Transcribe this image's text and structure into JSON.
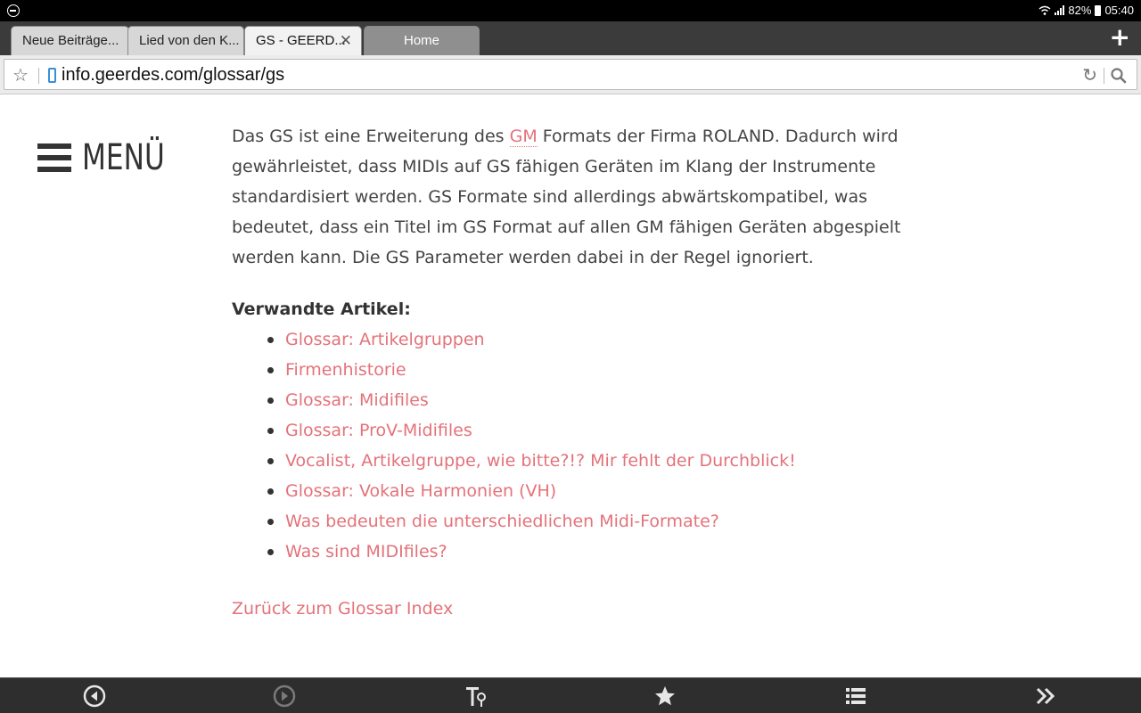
{
  "status_bar": {
    "battery": "82%",
    "time": "05:40"
  },
  "tabs": [
    {
      "label": "Neue Beiträge..."
    },
    {
      "label": "Lied von den K..."
    },
    {
      "label": "GS - GEERD...",
      "active": true
    },
    {
      "label": "Home"
    }
  ],
  "address_bar": {
    "url": "info.geerdes.com/glossar/gs"
  },
  "page": {
    "menu_label": "MENÜ",
    "intro_before_link": "Das GS ist eine Erweiterung des ",
    "intro_link": "GM",
    "intro_after_link": " Formats der Firma ROLAND. Dadurch wird gewährleistet, dass MIDIs auf GS fähigen Geräten im Klang der Instrumente standardisiert werden. GS Formate sind allerdings abwärtskompatibel, was bedeutet, dass ein Titel im GS Format auf allen GM fähigen Geräten abgespielt werden kann. Die GS Parameter werden dabei in der Regel ignoriert.",
    "related_title": "Verwandte Artikel:",
    "related_links": [
      "Glossar: Artikelgruppen",
      "Firmenhistorie",
      "Glossar: Midifiles",
      "Glossar: ProV-Midifiles",
      "Vocalist, Artikelgruppe, wie bitte?!? Mir fehlt der Durchblick!",
      "Glossar: Vokale Harmonien (VH)",
      "Was bedeuten die unterschiedlichen Midi-Formate?",
      "Was sind MIDIfiles?"
    ],
    "back_link": "Zurück zum Glossar Index"
  },
  "colors": {
    "link": "#e4727a",
    "text": "#444444",
    "toolbar": "#2e2e2e"
  },
  "bottom_toolbar": {
    "icons": [
      "back-icon",
      "forward-icon",
      "text-size-icon",
      "bookmark-star-icon",
      "list-icon",
      "more-chevrons-icon"
    ]
  }
}
